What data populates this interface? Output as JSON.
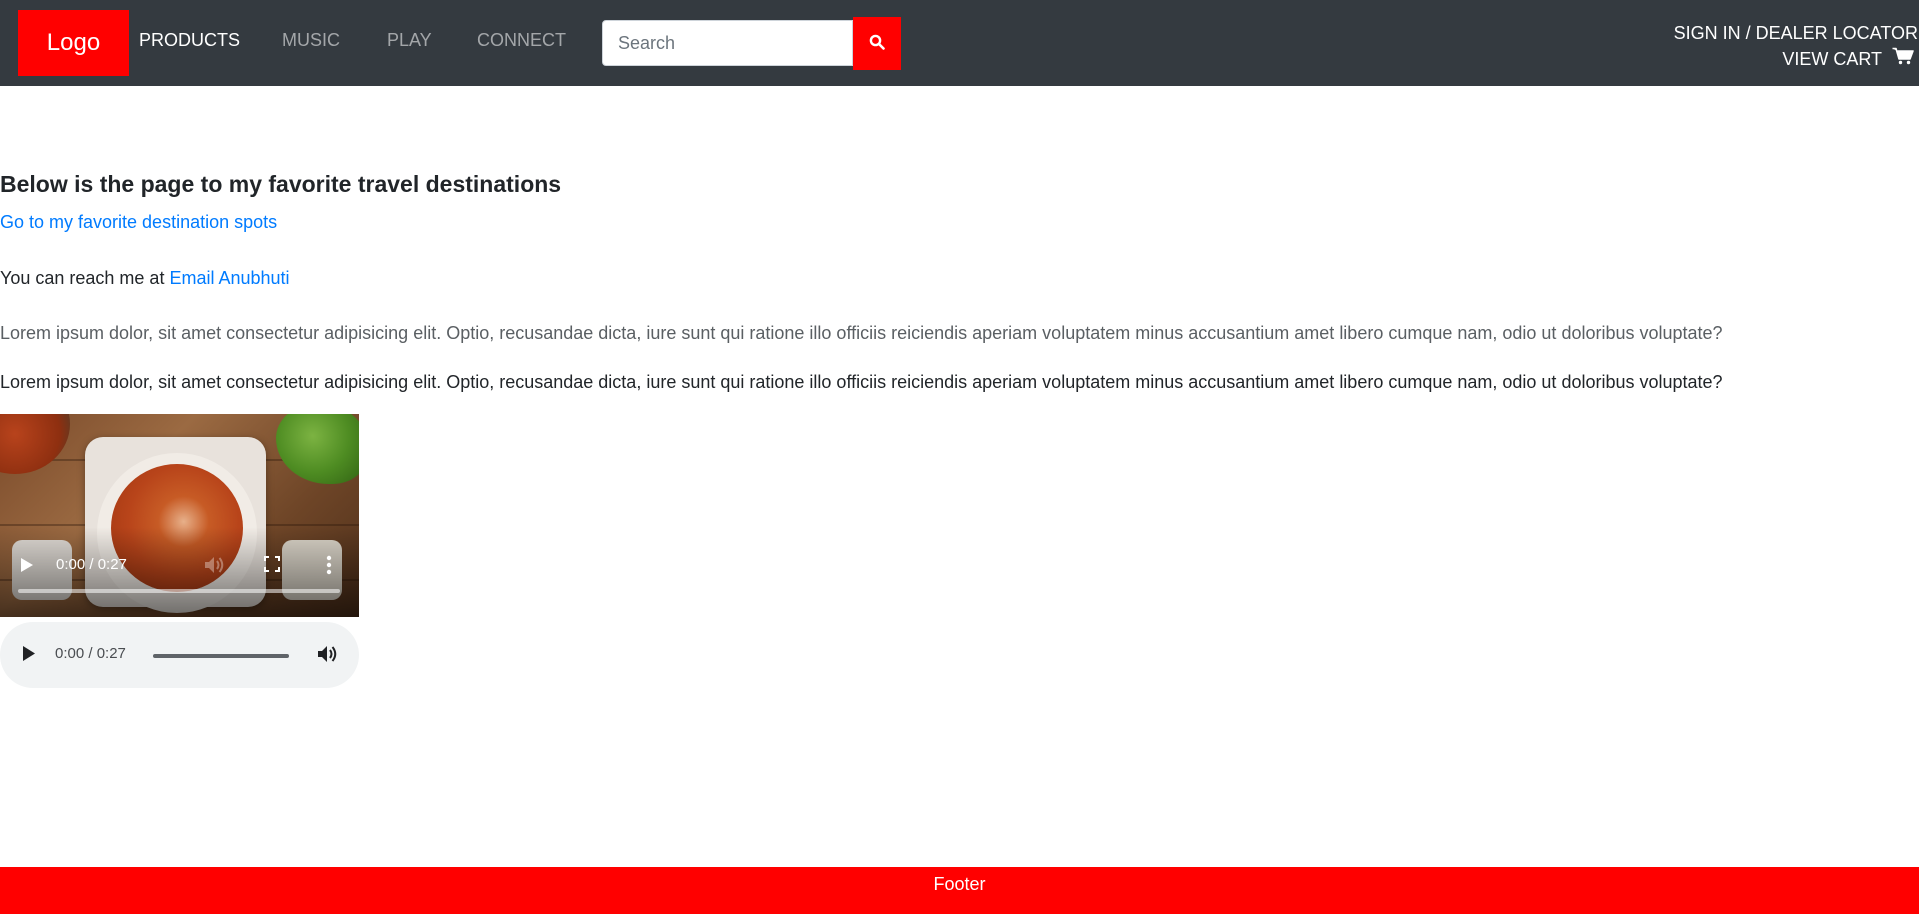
{
  "navbar": {
    "logo": "Logo",
    "items": [
      {
        "label": "PRODUCTS",
        "active": true
      },
      {
        "label": "MUSIC",
        "active": false
      },
      {
        "label": "PLAY",
        "active": false
      },
      {
        "label": "CONNECT",
        "active": false
      }
    ],
    "search": {
      "placeholder": "Search",
      "value": ""
    },
    "search_icon": "search-icon",
    "sign_in": "SIGN IN / DEALER LOCATOR",
    "view_cart": "VIEW CART",
    "cart_icon": "shopping-cart-icon"
  },
  "main": {
    "heading": "Below is the page to my favorite travel destinations",
    "destination_link": "Go to my favorite destination spots",
    "reach_prefix": "You can reach me at",
    "email_link": "Email Anubhuti",
    "paragraphs": [
      "Lorem ipsum dolor, sit amet consectetur adipisicing elit. Optio, recusandae dicta, iure sunt qui ratione illo officiis reiciendis aperiam voluptatem minus accusantium amet libero cumque nam, odio ut doloribus voluptate?",
      "Lorem ipsum dolor, sit amet consectetur adipisicing elit. Optio, recusandae dicta, iure sunt qui ratione illo officiis reiciendis aperiam voluptatem minus accusantium amet libero cumque nam, odio ut doloribus voluptate?"
    ]
  },
  "video": {
    "time": "0:00 / 0:27",
    "progress": 0,
    "icons": [
      "play-icon",
      "volume-icon",
      "fullscreen-icon",
      "more-options-icon"
    ]
  },
  "audio": {
    "time": "0:00 / 0:27",
    "progress": 0,
    "icons": [
      "play-icon",
      "volume-icon"
    ]
  },
  "footer": {
    "text": "Footer"
  },
  "colors": {
    "navbar_bg": "#343a40",
    "accent_red": "#ff0000",
    "link_blue": "#007bff"
  }
}
